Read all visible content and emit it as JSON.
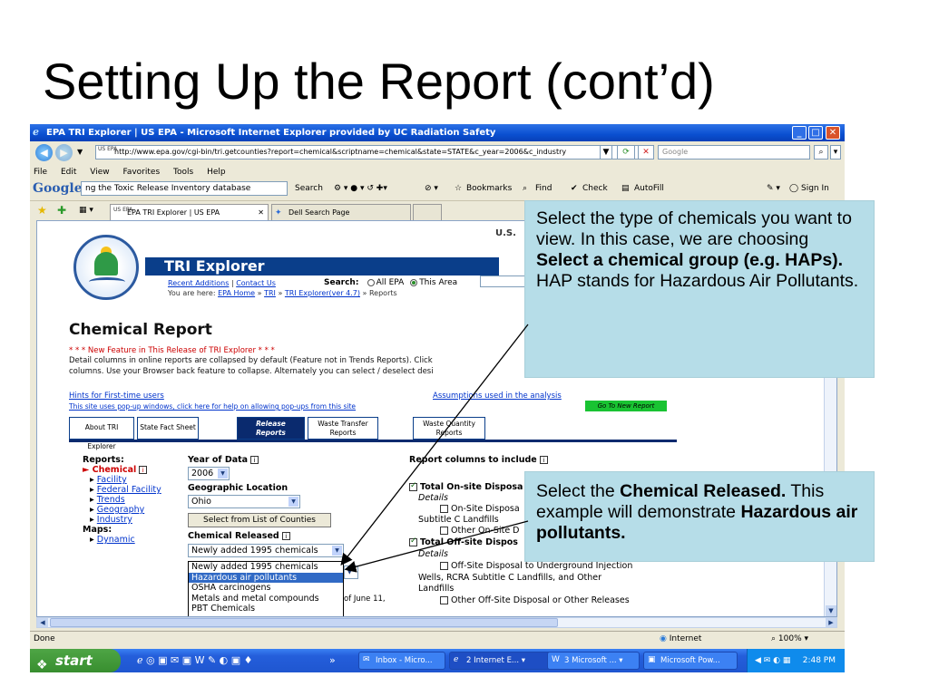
{
  "slide": {
    "title": "Setting Up the Report (cont’d)"
  },
  "window": {
    "title": "EPA TRI Explorer | US EPA - Microsoft Internet Explorer provided by UC Radiation Safety",
    "minimize": "_",
    "maximize": "□",
    "close": "✕"
  },
  "address": {
    "url": "http://www.epa.gov/cgi-bin/tri.getcounties?report=chemical&scriptname=chemical&state=STATE&c_year=2006&c_industry",
    "favicon": "US EPA",
    "search_placeholder": "Google"
  },
  "menu": [
    "File",
    "Edit",
    "View",
    "Favorites",
    "Tools",
    "Help"
  ],
  "google_toolbar": {
    "logo": "Google",
    "query": "ng the Toxic Release Inventory database",
    "search": "Search",
    "bookmarks": "Bookmarks",
    "find": "Find",
    "check": "Check",
    "autofill": "AutoFill",
    "signin": "Sign In"
  },
  "tabs": [
    {
      "label": "EPA TRI Explorer | US EPA",
      "icon_text": "US EPA"
    },
    {
      "label": "Dell Search Page"
    }
  ],
  "page": {
    "usa_banner": "U.S.",
    "tri_title": "TRI Explorer",
    "recent_additions": "Recent Additions",
    "contact_us": "Contact Us",
    "search_label": "Search:",
    "search_all": "All EPA",
    "search_area": "This Area",
    "you_are_here": "You are here:",
    "crumb_home": "EPA Home",
    "crumb_tri": "TRI",
    "crumb_explorer": "TRI Explorer(ver 4.7)",
    "crumb_reports": "Reports",
    "heading": "Chemical Report",
    "new_feature": "* * * New Feature in This Release of TRI Explorer * * *",
    "detail_line1": "Detail columns in online reports are collapsed by default (Feature not in Trends Reports). Click",
    "detail_line2": "columns. Use your Browser back feature to collapse. Alternately you can select / deselect desi",
    "hints": "Hints for First-time users",
    "assumptions": "Assumptions used in the analysis",
    "popups": "This site uses pop-up windows, click here for help on allowing pop-ups from this site",
    "go_new": "Go To New Report",
    "tab_about": "About TRI Explorer",
    "tab_state": "State Fact Sheet",
    "tab_release_1": "Release",
    "tab_release_2": "Reports",
    "tab_waste_transfer_1": "Waste Transfer",
    "tab_waste_transfer_2": "Reports",
    "tab_waste_qty_1": "Waste Quantity",
    "tab_waste_qty_2": "Reports",
    "nav_reports": "Reports:",
    "nav_chemical": "Chemical",
    "nav_facility": "Facility",
    "nav_federal": "Federal Facility",
    "nav_trends": "Trends",
    "nav_geography": "Geography",
    "nav_industry": "Industry",
    "nav_maps": "Maps:",
    "nav_dynamic": "Dynamic",
    "year_label": "Year of Data",
    "year_value": "2006",
    "geo_label": "Geographic Location",
    "geo_value": "Ohio",
    "counties_btn": "Select from List of Counties",
    "chem_label": "Chemical Released",
    "chem_value": "Newly added 1995 chemicals",
    "chem_options": [
      "Newly added 1995 chemicals",
      "Hazardous air pollutants",
      "OSHA carcinogens",
      "Metals and metal compounds",
      "PBT Chemicals"
    ],
    "as_of": "of June 11,",
    "rc_title": "Report columns to include",
    "rc_onsite": "Total On-site Disposa",
    "rc_details1": "Details",
    "rc_onsite_sub1": "On-Site Disposa",
    "rc_onsite_sub1b": "Subtitle C Landfills",
    "rc_onsite_sub2": "Other On-Site D",
    "rc_offsite": "Total Off-site Dispos",
    "rc_details2": "Details",
    "rc_off_1": "Off-Site Disposal to Underground Injection",
    "rc_off_1b": "Wells, RCRA Subtitle C Landfills, and Other",
    "rc_off_1c": "Landfills",
    "rc_off_2": "Other Off-Site Disposal or Other Releases"
  },
  "status": {
    "text": "Done",
    "zone": "Internet",
    "zoom": "100%"
  },
  "taskbar": {
    "start": "start",
    "items": [
      "Inbox - Micro...",
      "2 Internet E...",
      "3 Microsoft ...",
      "Microsoft Pow..."
    ],
    "clock": "2:48 PM"
  },
  "callouts": {
    "top_1": "Select the type of chemicals you want to view. In this case, we are choosing ",
    "top_bold": "Select a chemical group (e.g. HAPs).",
    "top_2": " HAP stands for Hazardous Air Pollutants.",
    "bottom_1": "Select the ",
    "bottom_bold1": "Chemical Released.",
    "bottom_2": " This example will demonstrate ",
    "bottom_bold2": "Hazardous air pollutants."
  },
  "colors": {
    "callout_bg": "#b6dde8",
    "titlebar": "#0a4fd0",
    "tri_band": "#0a3e8a",
    "selection": "#316ac5"
  }
}
